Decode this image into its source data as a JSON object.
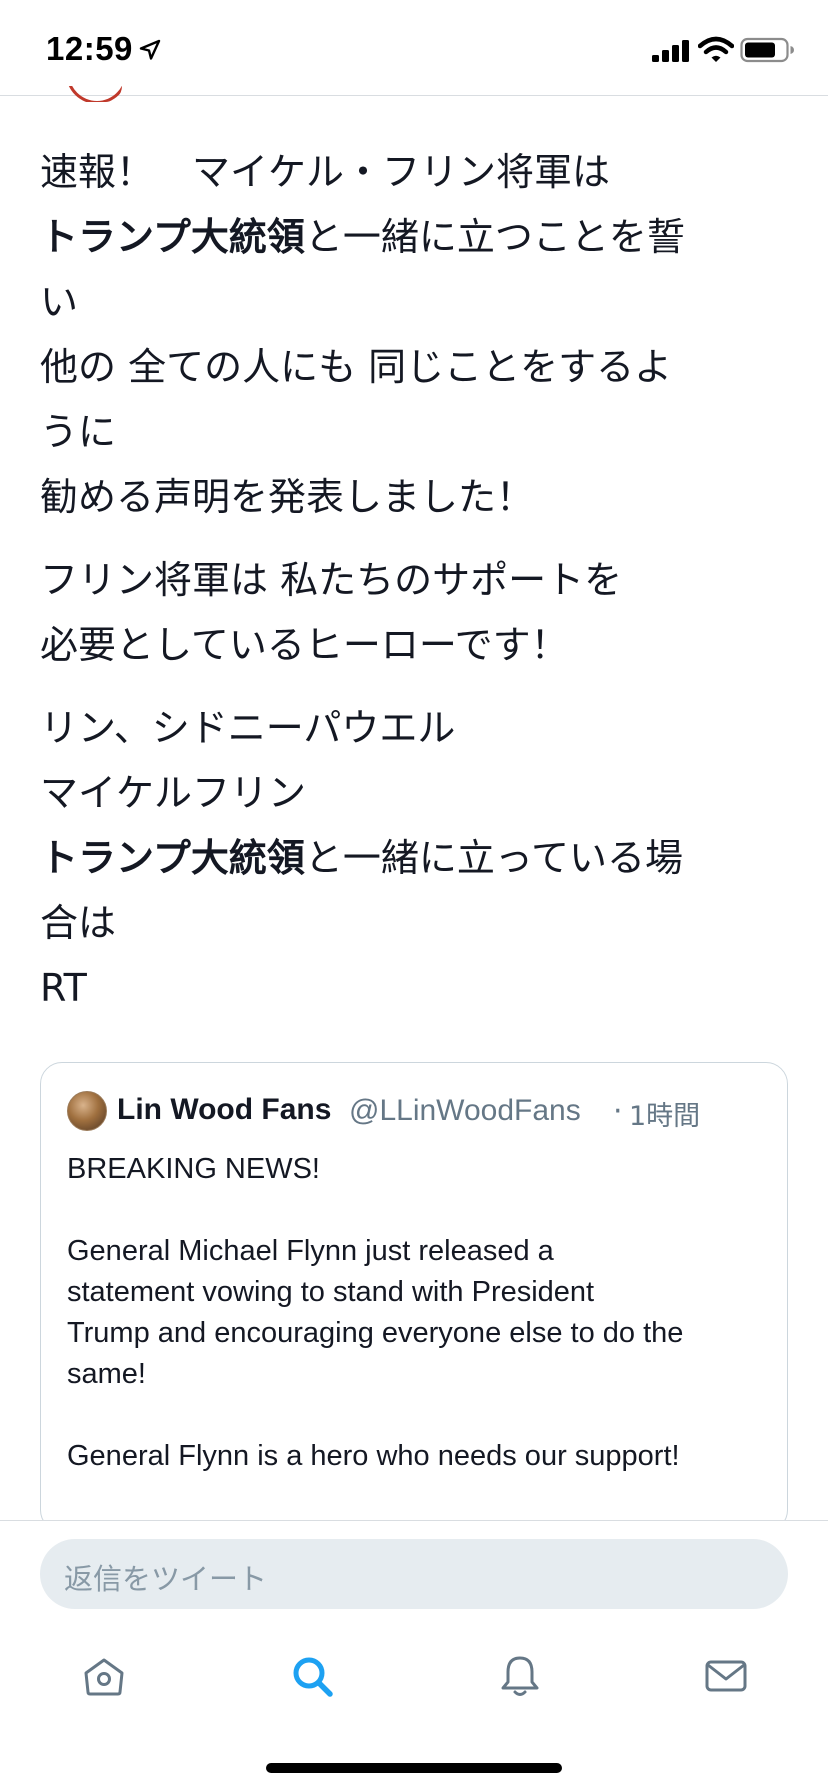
{
  "status_bar": {
    "time": "12:59",
    "icons": [
      "location-arrow-icon",
      "cellular-signal-icon",
      "wifi-icon",
      "battery-icon"
    ]
  },
  "tweet": {
    "paragraphs": [
      [
        [
          {
            "text": "速報！　マイケル・フリン将軍は",
            "bold": false
          }
        ],
        [
          {
            "text": "トランプ大統領",
            "bold": true
          },
          {
            "text": "と一緒に立つことを誓",
            "bold": false
          }
        ],
        [
          {
            "text": "い",
            "bold": false
          }
        ],
        [
          {
            "text": "他の 全ての人にも 同じことをするよ",
            "bold": false
          }
        ],
        [
          {
            "text": "うに",
            "bold": false
          }
        ],
        [
          {
            "text": "勧める声明を発表しました！",
            "bold": false
          }
        ]
      ],
      [
        [
          {
            "text": "フリン将軍は 私たちのサポートを",
            "bold": false
          }
        ],
        [
          {
            "text": "必要としているヒーローです！",
            "bold": false
          }
        ]
      ],
      [
        [
          {
            "text": "リン、シドニーパウエル",
            "bold": false
          }
        ],
        [
          {
            "text": "マイケルフリン",
            "bold": false
          }
        ],
        [
          {
            "text": "トランプ大統領",
            "bold": true
          },
          {
            "text": "と一緒に立っている場",
            "bold": false
          }
        ],
        [
          {
            "text": "合は",
            "bold": false
          }
        ],
        [
          {
            "text": "RT",
            "bold": false
          }
        ]
      ]
    ]
  },
  "quoted_tweet": {
    "name": "Lin Wood Fans",
    "handle": "@LLinWoodFans",
    "separator": "·",
    "time": "1時間",
    "lines": [
      "BREAKING NEWS!",
      "",
      "General Michael Flynn just released a",
      "statement vowing to stand with President",
      "Trump and encouraging everyone else to do the",
      "same!",
      "",
      "General Flynn is a hero who needs our support!"
    ]
  },
  "reply": {
    "placeholder": "返信をツイート"
  },
  "tab_bar": {
    "items": [
      {
        "icon": "home-icon",
        "active": false
      },
      {
        "icon": "search-icon",
        "active": true
      },
      {
        "icon": "notifications-bell-icon",
        "active": false
      },
      {
        "icon": "messages-envelope-icon",
        "active": false
      }
    ]
  },
  "colors": {
    "accent": "#1da1f2",
    "icon_inactive": "#657786",
    "text": "#141823",
    "secondary_text": "#657786",
    "reply_bg": "#e6ecf0"
  }
}
